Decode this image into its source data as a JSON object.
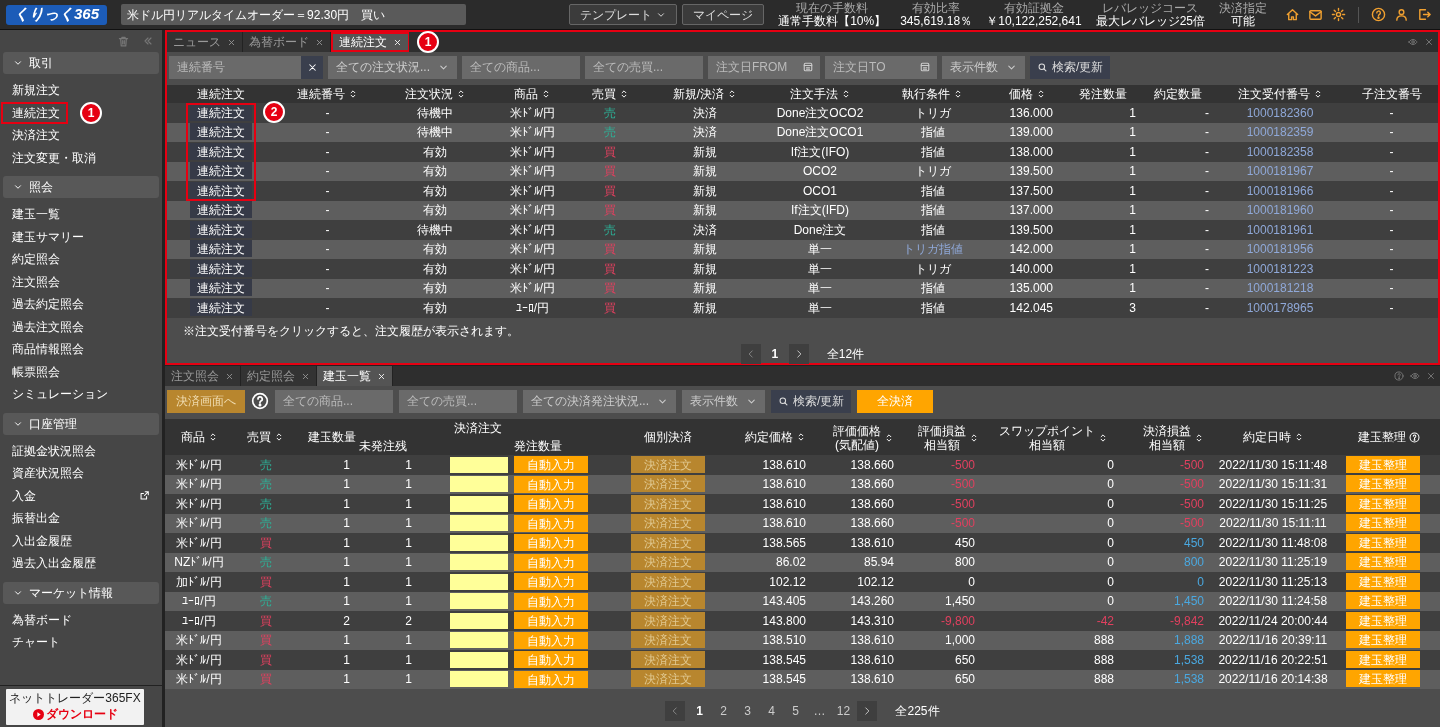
{
  "top_bar": {
    "logo": "くりっく365",
    "ticker": "米ドル円リアルタイムオーダー＝92.30円　買い",
    "buttons": [
      {
        "label": "テンプレート",
        "dropdown": true
      },
      {
        "label": "マイページ",
        "dropdown": false
      }
    ],
    "stats": [
      {
        "label": "現在の手数料",
        "value": "通常手数料【10%】"
      },
      {
        "label": "有効比率",
        "value": "345,619.18％"
      },
      {
        "label": "有効証拠金",
        "value": "￥10,122,252,641"
      },
      {
        "label": "レバレッジコース",
        "value": "最大レバレッジ25倍"
      },
      {
        "label": "決済指定",
        "value": "可能"
      }
    ]
  },
  "sidebar": {
    "sections": [
      {
        "title": "取引",
        "expanded": true,
        "items": [
          {
            "label": "新規注文",
            "highlighted": false,
            "external": false
          },
          {
            "label": "連続注文",
            "highlighted": true,
            "external": false,
            "callout": "1"
          },
          {
            "label": "決済注文",
            "highlighted": false,
            "external": false
          },
          {
            "label": "注文変更・取消",
            "highlighted": false,
            "external": false
          }
        ]
      },
      {
        "title": "照会",
        "expanded": true,
        "items": [
          {
            "label": "建玉一覧",
            "highlighted": false,
            "external": false
          },
          {
            "label": "建玉サマリー",
            "highlighted": false,
            "external": false
          },
          {
            "label": "約定照会",
            "highlighted": false,
            "external": false
          },
          {
            "label": "注文照会",
            "highlighted": false,
            "external": false
          },
          {
            "label": "過去約定照会",
            "highlighted": false,
            "external": false
          },
          {
            "label": "過去注文照会",
            "highlighted": false,
            "external": false
          },
          {
            "label": "商品情報照会",
            "highlighted": false,
            "external": false
          },
          {
            "label": "帳票照会",
            "highlighted": false,
            "external": false
          },
          {
            "label": "シミュレーション",
            "highlighted": false,
            "external": false
          }
        ]
      },
      {
        "title": "口座管理",
        "expanded": true,
        "items": [
          {
            "label": "証拠金状況照会",
            "highlighted": false,
            "external": false
          },
          {
            "label": "資産状況照会",
            "highlighted": false,
            "external": false
          },
          {
            "label": "入金",
            "highlighted": false,
            "external": true
          },
          {
            "label": "振替出金",
            "highlighted": false,
            "external": false
          },
          {
            "label": "入出金履歴",
            "highlighted": false,
            "external": false
          },
          {
            "label": "過去入出金履歴",
            "highlighted": false,
            "external": false
          }
        ]
      },
      {
        "title": "マーケット情報",
        "expanded": true,
        "items": [
          {
            "label": "為替ボード",
            "highlighted": false,
            "external": false
          },
          {
            "label": "チャート",
            "highlighted": false,
            "external": false
          }
        ]
      }
    ],
    "download": {
      "title": "ネットトレーダー365FX",
      "button": "ダウンロード"
    }
  },
  "order_panel": {
    "highlighted": true,
    "tabs": [
      {
        "label": "ニュース",
        "selected": false,
        "highlighted": false
      },
      {
        "label": "為替ボード",
        "selected": false,
        "highlighted": false
      },
      {
        "label": "連続注文",
        "selected": true,
        "highlighted": true,
        "callout": "1"
      }
    ],
    "filters": [
      {
        "kind": "clearable",
        "placeholder": "連続番号"
      },
      {
        "kind": "select",
        "label": "全ての注文状況..."
      },
      {
        "kind": "input",
        "placeholder": "全ての商品..."
      },
      {
        "kind": "input",
        "placeholder": "全ての売買..."
      },
      {
        "kind": "date",
        "placeholder": "注文日FROM"
      },
      {
        "kind": "date",
        "placeholder": "注文日TO"
      },
      {
        "kind": "select",
        "label": "表示件数"
      },
      {
        "kind": "search",
        "label": "検索/更新"
      }
    ],
    "columns": [
      {
        "label": "連続注文",
        "sortable": false
      },
      {
        "label": "連続番号",
        "sortable": true
      },
      {
        "label": "注文状況",
        "sortable": true
      },
      {
        "label": "商品",
        "sortable": true
      },
      {
        "label": "売買",
        "sortable": true
      },
      {
        "label": "新規/決済",
        "sortable": true
      },
      {
        "label": "注文手法",
        "sortable": true
      },
      {
        "label": "執行条件",
        "sortable": true
      },
      {
        "label": "価格",
        "sortable": true
      },
      {
        "label": "発注数量",
        "sortable": false
      },
      {
        "label": "約定数量",
        "sortable": false
      },
      {
        "label": "注文受付番号",
        "sortable": true
      },
      {
        "label": "子注文番号",
        "sortable": false
      }
    ],
    "rows_callout": "2",
    "rows": [
      {
        "action": "連続注文",
        "highlighted": true,
        "serial": "-",
        "status": "待機中",
        "product": "米ﾄﾞﾙ/円",
        "side": "売",
        "sell": true,
        "type": "決済",
        "method": "Done注文OCO2",
        "condition": "トリガ",
        "condition_link": false,
        "price": "136.000",
        "order_qty": "1",
        "filled_qty": "-",
        "order_no": "1000182360",
        "child_no": "-"
      },
      {
        "action": "連続注文",
        "highlighted": true,
        "serial": "-",
        "status": "待機中",
        "product": "米ﾄﾞﾙ/円",
        "side": "売",
        "sell": true,
        "type": "決済",
        "method": "Done注文OCO1",
        "condition": "指値",
        "condition_link": false,
        "price": "139.000",
        "order_qty": "1",
        "filled_qty": "-",
        "order_no": "1000182359",
        "child_no": "-"
      },
      {
        "action": "連続注文",
        "highlighted": true,
        "serial": "-",
        "status": "有効",
        "product": "米ﾄﾞﾙ/円",
        "side": "買",
        "sell": false,
        "type": "新規",
        "method": "If注文(IFO)",
        "condition": "指値",
        "condition_link": false,
        "price": "138.000",
        "order_qty": "1",
        "filled_qty": "-",
        "order_no": "1000182358",
        "child_no": "-"
      },
      {
        "action": "連続注文",
        "highlighted": true,
        "serial": "-",
        "status": "有効",
        "product": "米ﾄﾞﾙ/円",
        "side": "買",
        "sell": false,
        "type": "新規",
        "method": "OCO2",
        "condition": "トリガ",
        "condition_link": false,
        "price": "139.500",
        "order_qty": "1",
        "filled_qty": "-",
        "order_no": "1000181967",
        "child_no": "-"
      },
      {
        "action": "連続注文",
        "highlighted": true,
        "serial": "-",
        "status": "有効",
        "product": "米ﾄﾞﾙ/円",
        "side": "買",
        "sell": false,
        "type": "新規",
        "method": "OCO1",
        "condition": "指値",
        "condition_link": false,
        "price": "137.500",
        "order_qty": "1",
        "filled_qty": "-",
        "order_no": "1000181966",
        "child_no": "-"
      },
      {
        "action": "連続注文",
        "highlighted": false,
        "serial": "-",
        "status": "有効",
        "product": "米ﾄﾞﾙ/円",
        "side": "買",
        "sell": false,
        "type": "新規",
        "method": "If注文(IFD)",
        "condition": "指値",
        "condition_link": false,
        "price": "137.000",
        "order_qty": "1",
        "filled_qty": "-",
        "order_no": "1000181960",
        "child_no": "-"
      },
      {
        "action": "連続注文",
        "highlighted": false,
        "serial": "-",
        "status": "待機中",
        "product": "米ﾄﾞﾙ/円",
        "side": "売",
        "sell": true,
        "type": "決済",
        "method": "Done注文",
        "condition": "指値",
        "condition_link": false,
        "price": "139.500",
        "order_qty": "1",
        "filled_qty": "-",
        "order_no": "1000181961",
        "child_no": "-"
      },
      {
        "action": "連続注文",
        "highlighted": false,
        "serial": "-",
        "status": "有効",
        "product": "米ﾄﾞﾙ/円",
        "side": "買",
        "sell": false,
        "type": "新規",
        "method": "単一",
        "condition": "トリガ指値",
        "condition_link": true,
        "price": "142.000",
        "order_qty": "1",
        "filled_qty": "-",
        "order_no": "1000181956",
        "child_no": "-"
      },
      {
        "action": "連続注文",
        "highlighted": false,
        "serial": "-",
        "status": "有効",
        "product": "米ﾄﾞﾙ/円",
        "side": "買",
        "sell": false,
        "type": "新規",
        "method": "単一",
        "condition": "トリガ",
        "condition_link": false,
        "price": "140.000",
        "order_qty": "1",
        "filled_qty": "-",
        "order_no": "1000181223",
        "child_no": "-"
      },
      {
        "action": "連続注文",
        "highlighted": false,
        "serial": "-",
        "status": "有効",
        "product": "米ﾄﾞﾙ/円",
        "side": "買",
        "sell": false,
        "type": "新規",
        "method": "単一",
        "condition": "指値",
        "condition_link": false,
        "price": "135.000",
        "order_qty": "1",
        "filled_qty": "-",
        "order_no": "1000181218",
        "child_no": "-"
      },
      {
        "action": "連続注文",
        "highlighted": false,
        "serial": "-",
        "status": "有効",
        "product": "ﾕｰﾛ/円",
        "side": "買",
        "sell": false,
        "type": "新規",
        "method": "単一",
        "condition": "指値",
        "condition_link": false,
        "price": "142.045",
        "order_qty": "3",
        "filled_qty": "-",
        "order_no": "1000178965",
        "child_no": "-"
      }
    ],
    "note": "※注文受付番号をクリックすると、注文履歴が表示されます。",
    "pages": [
      {
        "label": "1",
        "selected": true
      }
    ],
    "total": "全12件"
  },
  "position_panel": {
    "tabs": [
      {
        "label": "注文照会",
        "selected": false
      },
      {
        "label": "約定照会",
        "selected": false
      },
      {
        "label": "建玉一覧",
        "selected": true
      }
    ],
    "toolbar": [
      {
        "kind": "muted",
        "label": "決済画面へ"
      },
      {
        "kind": "help"
      },
      {
        "kind": "input",
        "placeholder": "全ての商品..."
      },
      {
        "kind": "input",
        "placeholder": "全ての売買..."
      },
      {
        "kind": "select",
        "label": "全ての決済発注状況..."
      },
      {
        "kind": "select",
        "label": "表示件数"
      },
      {
        "kind": "search",
        "label": "検索/更新"
      },
      {
        "kind": "primary",
        "label": "全決済"
      }
    ],
    "columns": [
      {
        "label": "商品",
        "sortable": true
      },
      {
        "label": "売買",
        "sortable": true
      },
      {
        "label": "建玉数量",
        "sortable": false
      },
      {
        "label": "決済注文",
        "children": [
          {
            "label": "未発注残"
          },
          {
            "label": "発注数量"
          }
        ]
      },
      {
        "label": "個別決済",
        "sortable": false
      },
      {
        "label": "約定価格",
        "sortable": true
      },
      {
        "label": "評価価格",
        "sublabel": "(気配値)",
        "sortable": true
      },
      {
        "label": "評価損益",
        "sublabel": "相当額",
        "sortable": true
      },
      {
        "label": "スワップポイント",
        "sublabel": "相当額",
        "sortable": true
      },
      {
        "label": "決済損益",
        "sublabel": "相当額",
        "sortable": true
      },
      {
        "label": "約定日時",
        "sortable": true
      },
      {
        "label": "建玉整理",
        "sortable": false,
        "help": true
      }
    ],
    "rows": [
      {
        "product": "米ﾄﾞﾙ/円",
        "side": "売",
        "sell": true,
        "qty": "1",
        "unissued": "1",
        "auto": "自動入力",
        "settle": "決済注文",
        "settle_disabled": true,
        "trade_price": "138.610",
        "eval_price": "138.660",
        "eval_pl": "-500",
        "loss": true,
        "swap": "0",
        "swap_loss": false,
        "settle_pl": "-500",
        "time": "2022/11/30 15:11:48",
        "tidy": "建玉整理"
      },
      {
        "product": "米ﾄﾞﾙ/円",
        "side": "売",
        "sell": true,
        "qty": "1",
        "unissued": "1",
        "auto": "自動入力",
        "settle": "決済注文",
        "settle_disabled": true,
        "trade_price": "138.610",
        "eval_price": "138.660",
        "eval_pl": "-500",
        "loss": true,
        "swap": "0",
        "swap_loss": false,
        "settle_pl": "-500",
        "time": "2022/11/30 15:11:31",
        "tidy": "建玉整理"
      },
      {
        "product": "米ﾄﾞﾙ/円",
        "side": "売",
        "sell": true,
        "qty": "1",
        "unissued": "1",
        "auto": "自動入力",
        "settle": "決済注文",
        "settle_disabled": true,
        "trade_price": "138.610",
        "eval_price": "138.660",
        "eval_pl": "-500",
        "loss": true,
        "swap": "0",
        "swap_loss": false,
        "settle_pl": "-500",
        "time": "2022/11/30 15:11:25",
        "tidy": "建玉整理"
      },
      {
        "product": "米ﾄﾞﾙ/円",
        "side": "売",
        "sell": true,
        "qty": "1",
        "unissued": "1",
        "auto": "自動入力",
        "settle": "決済注文",
        "settle_disabled": true,
        "trade_price": "138.610",
        "eval_price": "138.660",
        "eval_pl": "-500",
        "loss": true,
        "swap": "0",
        "swap_loss": false,
        "settle_pl": "-500",
        "time": "2022/11/30 15:11:11",
        "tidy": "建玉整理"
      },
      {
        "product": "米ﾄﾞﾙ/円",
        "side": "買",
        "sell": false,
        "qty": "1",
        "unissued": "1",
        "auto": "自動入力",
        "settle": "決済注文",
        "settle_disabled": true,
        "trade_price": "138.565",
        "eval_price": "138.610",
        "eval_pl": "450",
        "loss": false,
        "swap": "0",
        "swap_loss": false,
        "settle_pl": "450",
        "time": "2022/11/30 11:48:08",
        "tidy": "建玉整理"
      },
      {
        "product": "NZﾄﾞﾙ/円",
        "side": "売",
        "sell": true,
        "qty": "1",
        "unissued": "1",
        "auto": "自動入力",
        "settle": "決済注文",
        "settle_disabled": true,
        "trade_price": "86.02",
        "eval_price": "85.94",
        "eval_pl": "800",
        "loss": false,
        "swap": "0",
        "swap_loss": false,
        "settle_pl": "800",
        "time": "2022/11/30 11:25:19",
        "tidy": "建玉整理"
      },
      {
        "product": "加ﾄﾞﾙ/円",
        "side": "買",
        "sell": false,
        "qty": "1",
        "unissued": "1",
        "auto": "自動入力",
        "settle": "決済注文",
        "settle_disabled": true,
        "trade_price": "102.12",
        "eval_price": "102.12",
        "eval_pl": "0",
        "loss": false,
        "swap": "0",
        "swap_loss": false,
        "settle_pl": "0",
        "time": "2022/11/30 11:25:13",
        "tidy": "建玉整理"
      },
      {
        "product": "ﾕｰﾛ/円",
        "side": "売",
        "sell": true,
        "qty": "1",
        "unissued": "1",
        "auto": "自動入力",
        "settle": "決済注文",
        "settle_disabled": true,
        "trade_price": "143.405",
        "eval_price": "143.260",
        "eval_pl": "1,450",
        "loss": false,
        "swap": "0",
        "swap_loss": false,
        "settle_pl": "1,450",
        "time": "2022/11/30 11:24:58",
        "tidy": "建玉整理"
      },
      {
        "product": "ﾕｰﾛ/円",
        "side": "買",
        "sell": false,
        "qty": "2",
        "unissued": "2",
        "auto": "自動入力",
        "settle": "決済注文",
        "settle_disabled": true,
        "trade_price": "143.800",
        "eval_price": "143.310",
        "eval_pl": "-9,800",
        "loss": true,
        "swap": "-42",
        "swap_loss": true,
        "settle_pl": "-9,842",
        "time": "2022/11/24 20:00:44",
        "tidy": "建玉整理"
      },
      {
        "product": "米ﾄﾞﾙ/円",
        "side": "買",
        "sell": false,
        "qty": "1",
        "unissued": "1",
        "auto": "自動入力",
        "settle": "決済注文",
        "settle_disabled": true,
        "trade_price": "138.510",
        "eval_price": "138.610",
        "eval_pl": "1,000",
        "loss": false,
        "swap": "888",
        "swap_loss": false,
        "settle_pl": "1,888",
        "time": "2022/11/16 20:39:11",
        "tidy": "建玉整理"
      },
      {
        "product": "米ﾄﾞﾙ/円",
        "side": "買",
        "sell": false,
        "qty": "1",
        "unissued": "1",
        "auto": "自動入力",
        "settle": "決済注文",
        "settle_disabled": true,
        "trade_price": "138.545",
        "eval_price": "138.610",
        "eval_pl": "650",
        "loss": false,
        "swap": "888",
        "swap_loss": false,
        "settle_pl": "1,538",
        "time": "2022/11/16 20:22:51",
        "tidy": "建玉整理"
      },
      {
        "product": "米ﾄﾞﾙ/円",
        "side": "買",
        "sell": false,
        "qty": "1",
        "unissued": "1",
        "auto": "自動入力",
        "settle": "決済注文",
        "settle_disabled": true,
        "trade_price": "138.545",
        "eval_price": "138.610",
        "eval_pl": "650",
        "loss": false,
        "swap": "888",
        "swap_loss": false,
        "settle_pl": "1,538",
        "time": "2022/11/16 20:14:38",
        "tidy": "建玉整理"
      }
    ],
    "pages": [
      {
        "label": "1",
        "selected": true
      },
      {
        "label": "2",
        "selected": false
      },
      {
        "label": "3",
        "selected": false
      },
      {
        "label": "4",
        "selected": false
      },
      {
        "label": "5",
        "selected": false
      },
      {
        "label": "…",
        "selected": false
      },
      {
        "label": "12",
        "selected": false
      }
    ],
    "total": "全225件"
  }
}
